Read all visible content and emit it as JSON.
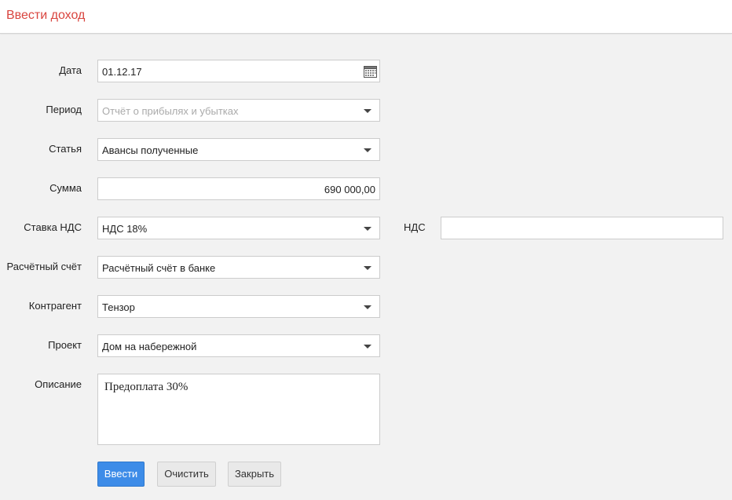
{
  "header": {
    "title": "Ввести доход"
  },
  "form": {
    "date": {
      "label": "Дата",
      "value": "01.12.17",
      "icon": "calendar-icon"
    },
    "period": {
      "label": "Период",
      "placeholder": "Отчёт о прибылях и убытках"
    },
    "article": {
      "label": "Статья",
      "value": "Авансы полученные"
    },
    "amount": {
      "label": "Сумма",
      "value": "690 000,00"
    },
    "vat_rate": {
      "label": "Ставка НДС",
      "value": "НДС 18%"
    },
    "vat": {
      "label": "НДС",
      "value": ""
    },
    "account": {
      "label": "Расчётный счёт",
      "value": "Расчётный счёт в банке"
    },
    "counterparty": {
      "label": "Контрагент",
      "value": "Тензор"
    },
    "project": {
      "label": "Проект",
      "value": "Дом на набережной"
    },
    "description": {
      "label": "Описание",
      "value": "Предоплата 30%"
    }
  },
  "buttons": {
    "submit": "Ввести",
    "clear": "Очистить",
    "close": "Закрыть"
  },
  "colors": {
    "title": "#d9453f",
    "primary_button": "#3d8ce8",
    "background": "#f2f2f2"
  }
}
